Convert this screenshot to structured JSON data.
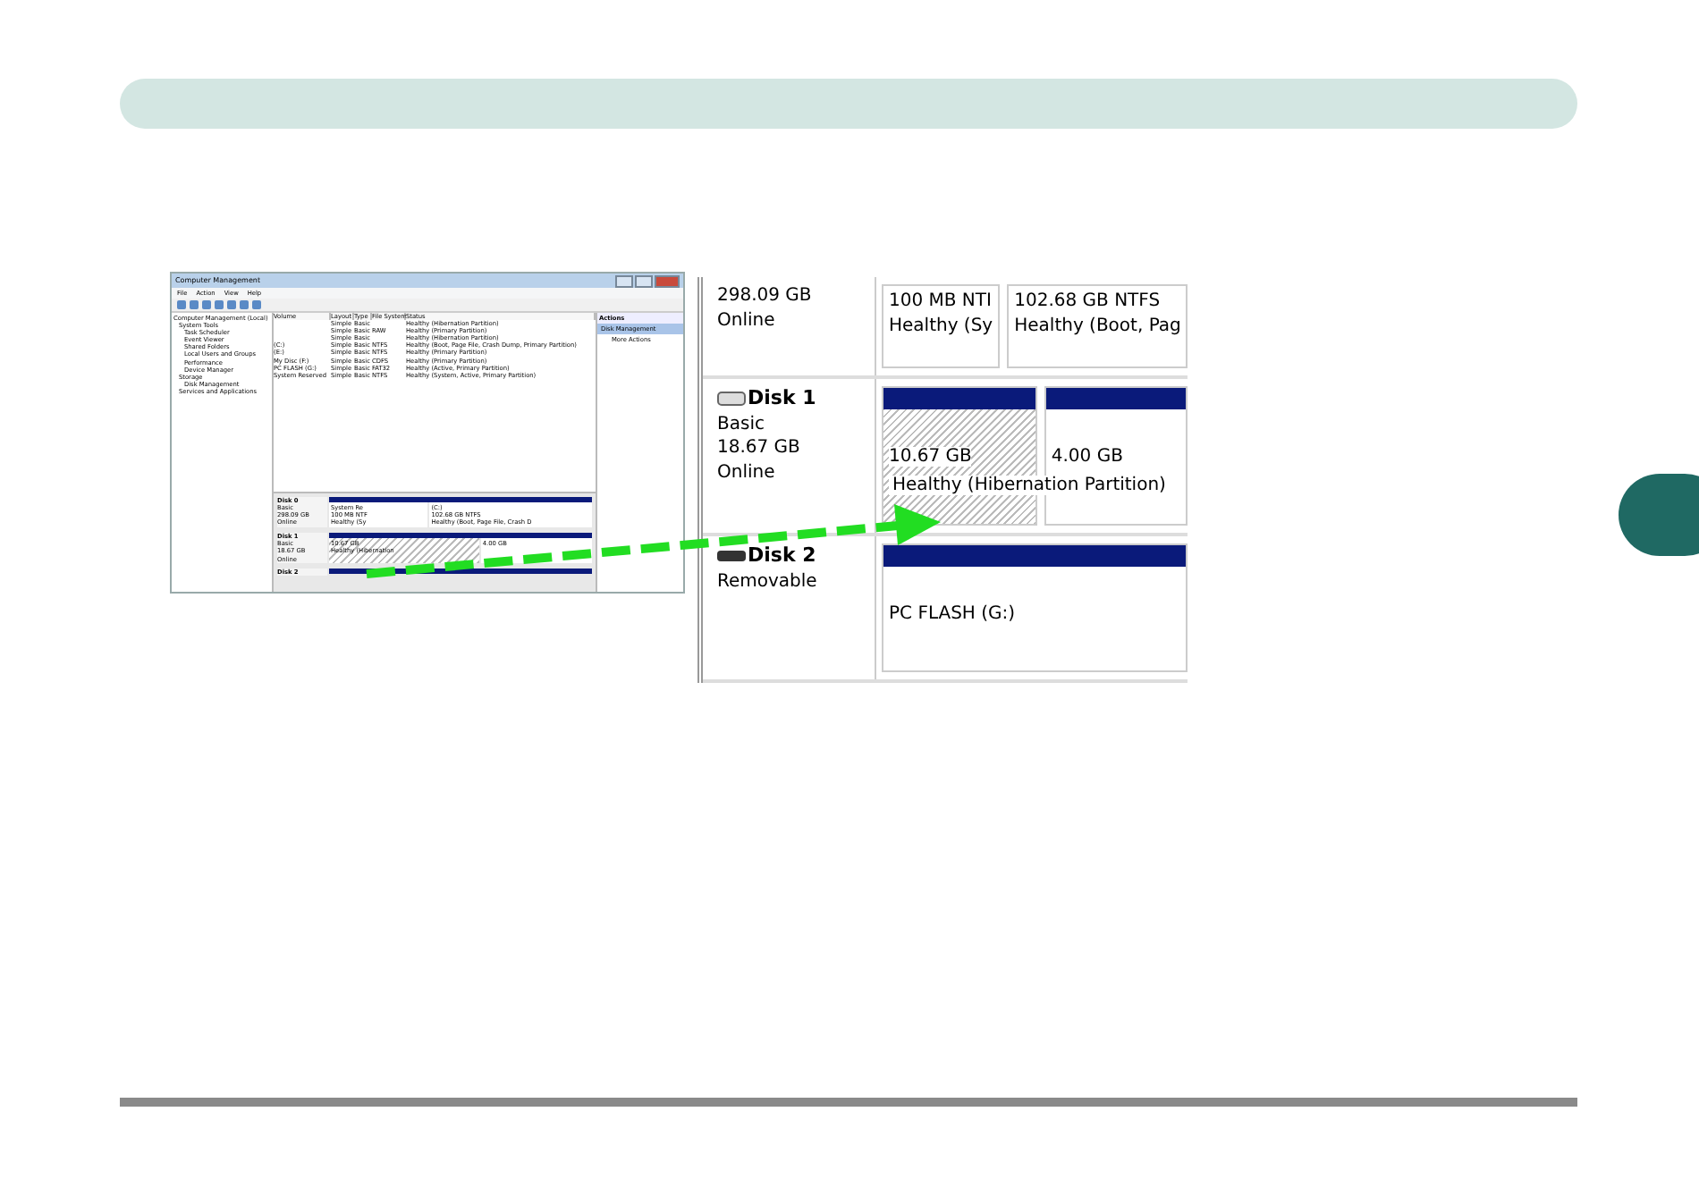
{
  "small_screenshot": {
    "title": "Computer Management",
    "menu": [
      "File",
      "Action",
      "View",
      "Help"
    ],
    "tree": [
      {
        "label": "Computer Management (Local)",
        "children": [
          {
            "label": "System Tools",
            "children": [
              {
                "label": "Task Scheduler"
              },
              {
                "label": "Event Viewer"
              },
              {
                "label": "Shared Folders"
              },
              {
                "label": "Local Users and Groups"
              },
              {
                "label": "Performance"
              },
              {
                "label": "Device Manager"
              }
            ]
          },
          {
            "label": "Storage",
            "children": [
              {
                "label": "Disk Management"
              }
            ]
          },
          {
            "label": "Services and Applications"
          }
        ]
      }
    ],
    "columns": [
      "Volume",
      "Layout",
      "Type",
      "File System",
      "Status"
    ],
    "rows": [
      [
        null,
        "Simple",
        "Basic",
        null,
        "Healthy (Hibernation Partition)"
      ],
      [
        null,
        "Simple",
        "Basic",
        "RAW",
        "Healthy (Primary Partition)"
      ],
      [
        null,
        "Simple",
        "Basic",
        null,
        "Healthy (Hibernation Partition)"
      ],
      [
        "(C:)",
        "Simple",
        "Basic",
        "NTFS",
        "Healthy (Boot, Page File, Crash Dump, Primary Partition)"
      ],
      [
        "(E:)",
        "Simple",
        "Basic",
        "NTFS",
        "Healthy (Primary Partition)"
      ],
      [
        "My Disc (F:)",
        "Simple",
        "Basic",
        "CDFS",
        "Healthy (Primary Partition)"
      ],
      [
        "PC FLASH (G:)",
        "Simple",
        "Basic",
        "FAT32",
        "Healthy (Active, Primary Partition)"
      ],
      [
        "System Reserved",
        "Simple",
        "Basic",
        "NTFS",
        "Healthy (System, Active, Primary Partition)"
      ]
    ],
    "actions": {
      "title": "Actions",
      "items": [
        {
          "label": "Disk Management",
          "selected": true
        },
        {
          "label": "More Actions",
          "selected": false
        }
      ]
    },
    "disks": [
      {
        "name": "Disk 0",
        "lines": [
          "Basic",
          "298.09 GB",
          "Online"
        ],
        "partitions": [
          {
            "lines": [
              "System Re",
              "100 MB NTF",
              "Healthy (Sy"
            ],
            "hatched": false
          },
          {
            "lines": [
              "(C:)",
              "102.68 GB NTFS",
              "Healthy (Boot, Page File, Crash D"
            ],
            "hatched": false
          }
        ]
      },
      {
        "name": "Disk 1",
        "lines": [
          "Basic",
          "18.67 GB",
          "Online"
        ],
        "partitions": [
          {
            "lines": [
              "10.67 GB",
              "Healthy (Hibernation"
            ],
            "hatched": true
          },
          {
            "lines": [
              "4.00 GB"
            ],
            "hatched": false
          }
        ]
      },
      {
        "name": "Disk 2"
      }
    ]
  },
  "zoomed_view": {
    "disks": [
      {
        "lines": [
          "298.09 GB",
          "Online"
        ],
        "partitions": [
          {
            "lines": [
              "100 MB NTI",
              "Healthy (Sy"
            ],
            "hatched": false,
            "bar": false
          },
          {
            "lines": [
              "102.68 GB NTFS",
              "Healthy (Boot, Pag"
            ],
            "hatched": false,
            "bar": false
          }
        ]
      },
      {
        "name": "Disk 1",
        "lines": [
          "Basic",
          "18.67 GB",
          "Online"
        ],
        "overlay": "Healthy (Hibernation Partition)",
        "partitions": [
          {
            "lines": [
              "10.67 GB"
            ],
            "hatched": true,
            "bar": true
          },
          {
            "lines": [
              "4.00 GB"
            ],
            "hatched": false,
            "bar": true
          }
        ]
      },
      {
        "name": "Disk 2",
        "lines": [
          "Removable"
        ],
        "partitions": [
          {
            "lines": [
              "PC FLASH (G:)"
            ],
            "hatched": false,
            "bar": true
          }
        ]
      }
    ]
  }
}
